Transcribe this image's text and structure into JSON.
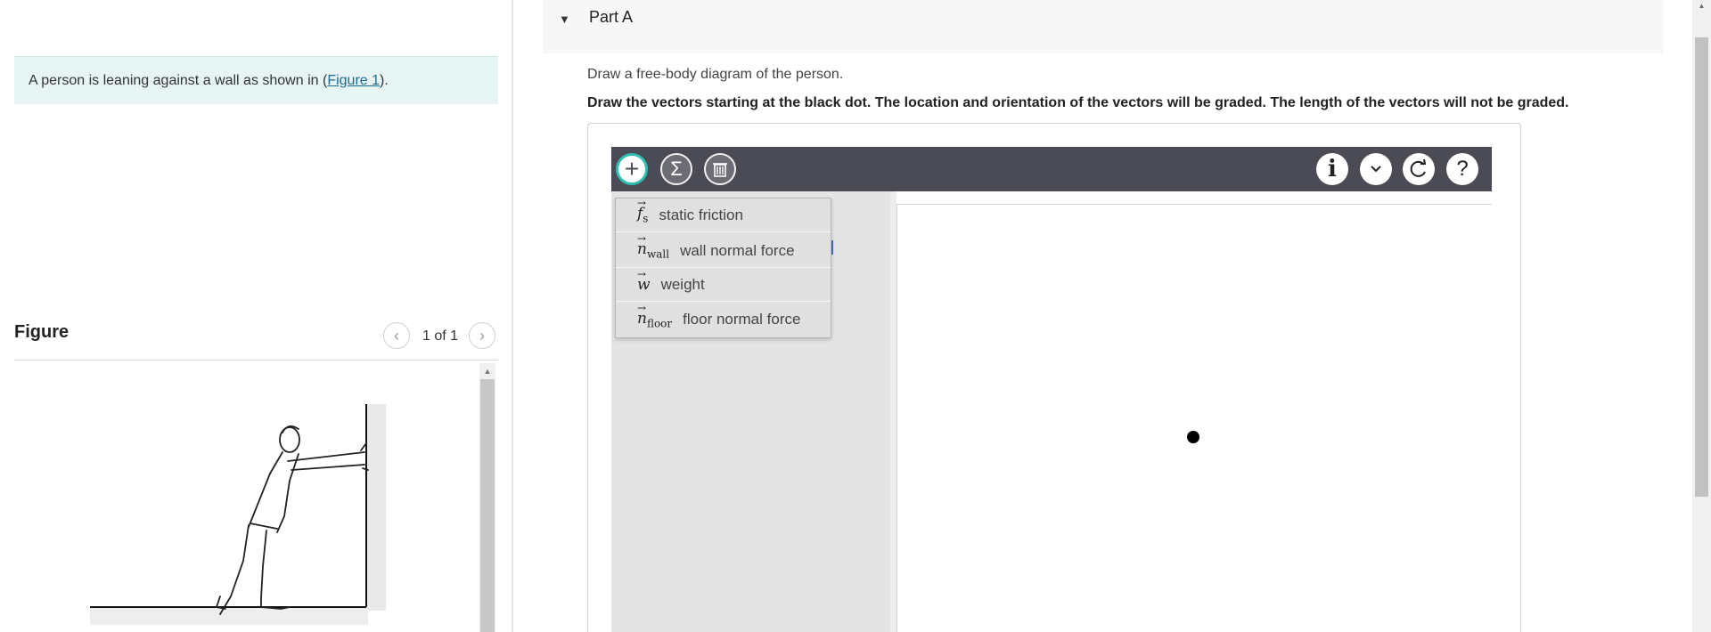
{
  "prompt": {
    "text_before": "A person is leaning against a wall as shown in (",
    "link": "Figure 1",
    "text_after": ")."
  },
  "figure": {
    "title": "Figure",
    "count": "1 of 1",
    "prev_icon": "chevron-left-icon",
    "next_icon": "chevron-right-icon"
  },
  "part": {
    "title": "Part A",
    "instruction": "Draw a free-body diagram of the person.",
    "instruction_bold": "Draw the vectors starting at the black dot. The location and orientation of the vectors will be graded. The length of the vectors will not be graded."
  },
  "toolbar": {
    "left_tools": [
      "add-vector-icon",
      "sum-icon",
      "trash-icon"
    ],
    "right_tools": [
      "info-icon",
      "chevron-down-icon",
      "reset-icon",
      "help-icon"
    ],
    "accent": "#2ebfb1",
    "bar_color": "#4b4b55"
  },
  "vector_menu": [
    {
      "symbol": "f",
      "subscript": "s",
      "label": "static friction"
    },
    {
      "symbol": "n",
      "subscript": "wall",
      "label": "wall normal force"
    },
    {
      "symbol": "w",
      "subscript": "",
      "label": "weight"
    },
    {
      "symbol": "n",
      "subscript": "floor",
      "label": "floor normal force"
    }
  ]
}
